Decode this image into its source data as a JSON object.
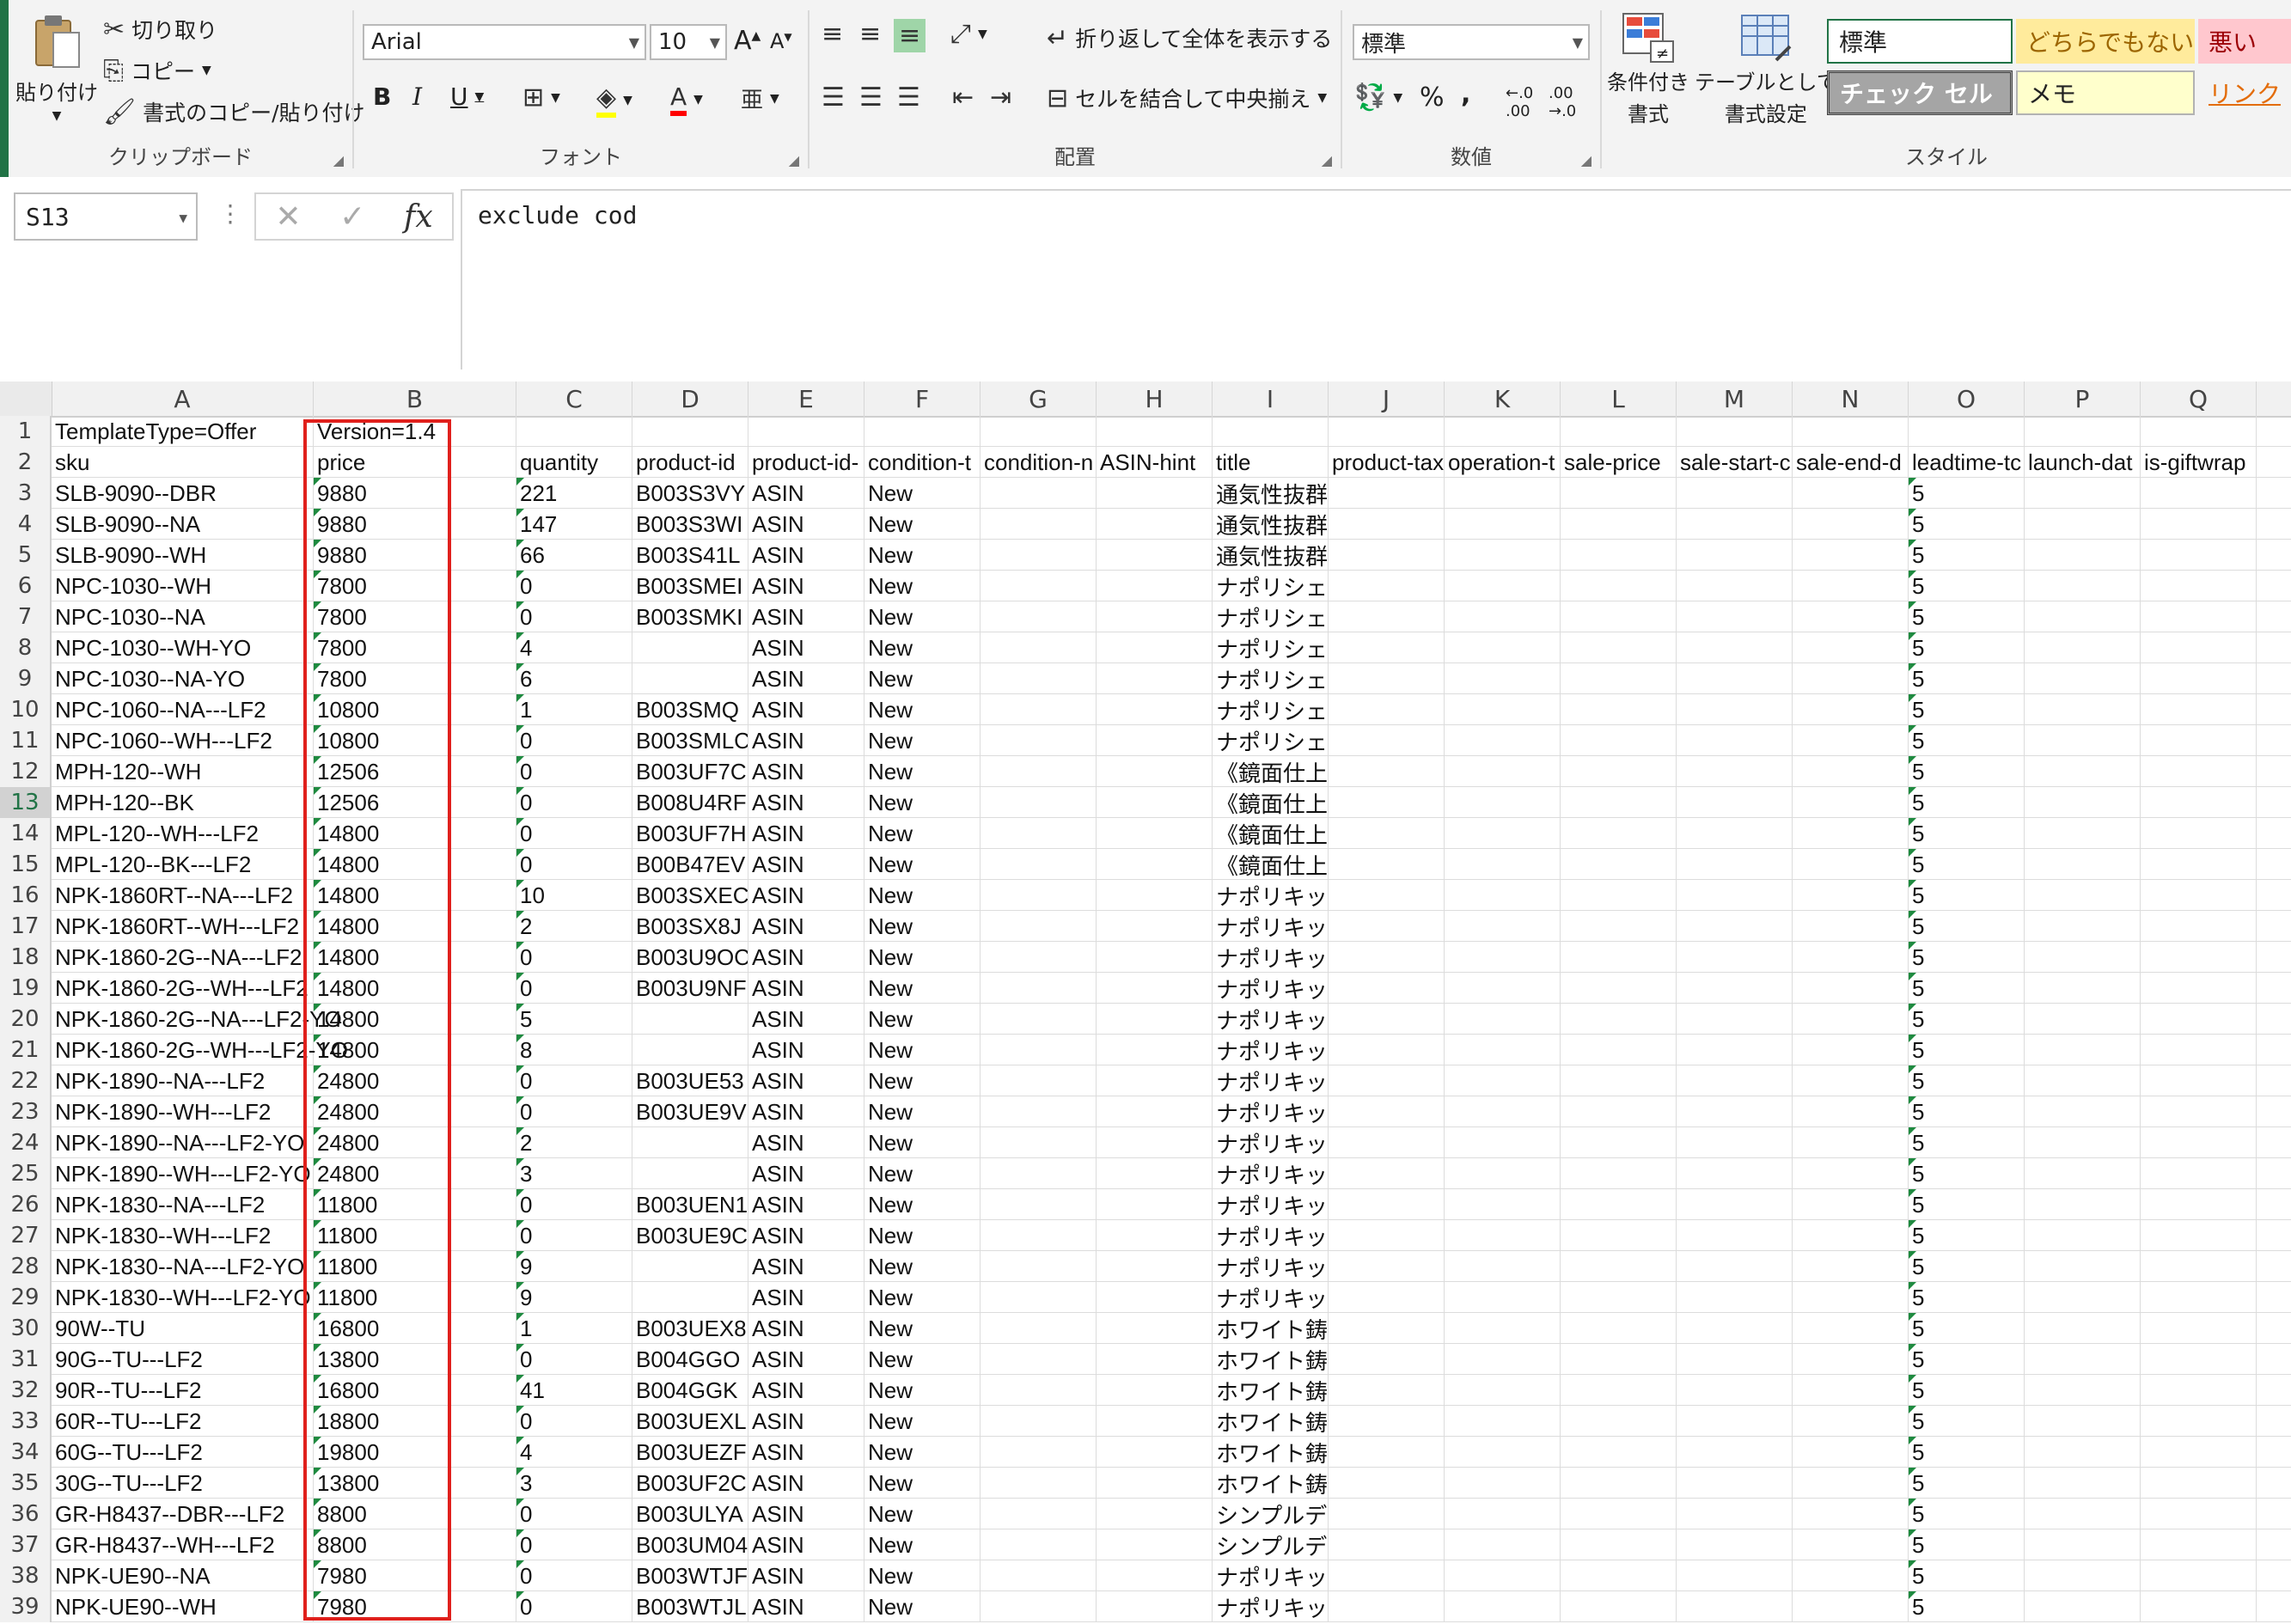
{
  "ribbon": {
    "clipboard": {
      "paste": "貼り付け",
      "cut": "切り取り",
      "copy": "コピー",
      "format_painter": "書式のコピー/貼り付け",
      "label": "クリップボード"
    },
    "font": {
      "name": "Arial",
      "size": "10",
      "bold": "B",
      "italic": "I",
      "underline": "U",
      "label": "フォント"
    },
    "alignment": {
      "wrap_text": "折り返して全体を表示する",
      "merge_center": "セルを結合して中央揃え",
      "label": "配置"
    },
    "number": {
      "format": "標準",
      "percent": "%",
      "comma": ",",
      "label": "数値"
    },
    "styles": {
      "conditional": [
        "条件付き",
        "書式"
      ],
      "format_table": [
        "テーブルとして",
        "書式設定"
      ],
      "normal": "標準",
      "neutral": "どちらでもない",
      "bad": "悪い",
      "check_cell": "チェック セル",
      "note": "メモ",
      "link": "リンク",
      "label": "スタイル"
    },
    "colors": {
      "accent": "#217346",
      "neutral_bg": "#ffeb9c",
      "neutral_fg": "#9c6500",
      "bad_bg": "#ffc7ce",
      "bad_fg": "#9c0006",
      "check_bg": "#a5a5a5",
      "link_fg": "#e36c09",
      "highlight_red": "#e0201c"
    }
  },
  "formula_bar": {
    "name_box": "S13",
    "fx": "fx",
    "content": "exclude cod"
  },
  "sheet": {
    "selected_row": "13",
    "columns": [
      "A",
      "B",
      "C",
      "D",
      "E",
      "F",
      "G",
      "H",
      "I",
      "J",
      "K",
      "L",
      "M",
      "N",
      "O",
      "P",
      "Q"
    ],
    "rows": [
      {
        "n": "1",
        "cells": [
          "TemplateType=Offer",
          "Version=1.4",
          "",
          "",
          "",
          "",
          "",
          "",
          "",
          "",
          "",
          "",
          "",
          "",
          "",
          "",
          ""
        ]
      },
      {
        "n": "2",
        "cells": [
          "sku",
          "price",
          "quantity",
          "product-id",
          "product-id-",
          "condition-t",
          "condition-n",
          "ASIN-hint",
          "title",
          "product-tax",
          "operation-t",
          "sale-price",
          "sale-start-c",
          "sale-end-d",
          "leadtime-tc",
          "launch-dat",
          "is-giftwrap"
        ]
      },
      {
        "n": "3",
        "cells": [
          "SLB-9090--DBR",
          "9880",
          "221",
          "B003S3VY",
          "ASIN",
          "New",
          "",
          "",
          "通気性抜群",
          "",
          "",
          "",
          "",
          "",
          "5",
          "",
          ""
        ]
      },
      {
        "n": "4",
        "cells": [
          "SLB-9090--NA",
          "9880",
          "147",
          "B003S3WI",
          "ASIN",
          "New",
          "",
          "",
          "通気性抜群",
          "",
          "",
          "",
          "",
          "",
          "5",
          "",
          ""
        ]
      },
      {
        "n": "5",
        "cells": [
          "SLB-9090--WH",
          "9880",
          "66",
          "B003S41L",
          "ASIN",
          "New",
          "",
          "",
          "通気性抜群",
          "",
          "",
          "",
          "",
          "",
          "5",
          "",
          ""
        ]
      },
      {
        "n": "6",
        "cells": [
          "NPC-1030--WH",
          "7800",
          "0",
          "B003SMEI",
          "ASIN",
          "New",
          "",
          "",
          "ナポリシェ",
          "",
          "",
          "",
          "",
          "",
          "5",
          "",
          ""
        ]
      },
      {
        "n": "7",
        "cells": [
          "NPC-1030--NA",
          "7800",
          "0",
          "B003SMKI",
          "ASIN",
          "New",
          "",
          "",
          "ナポリシェ",
          "",
          "",
          "",
          "",
          "",
          "5",
          "",
          ""
        ]
      },
      {
        "n": "8",
        "cells": [
          "NPC-1030--WH-YO",
          "7800",
          "4",
          "",
          "ASIN",
          "New",
          "",
          "",
          "ナポリシェ",
          "",
          "",
          "",
          "",
          "",
          "5",
          "",
          ""
        ]
      },
      {
        "n": "9",
        "cells": [
          "NPC-1030--NA-YO",
          "7800",
          "6",
          "",
          "ASIN",
          "New",
          "",
          "",
          "ナポリシェ",
          "",
          "",
          "",
          "",
          "",
          "5",
          "",
          ""
        ]
      },
      {
        "n": "10",
        "cells": [
          "NPC-1060--NA---LF2",
          "10800",
          "1",
          "B003SMQ",
          "ASIN",
          "New",
          "",
          "",
          "ナポリシェ",
          "",
          "",
          "",
          "",
          "",
          "5",
          "",
          ""
        ]
      },
      {
        "n": "11",
        "cells": [
          "NPC-1060--WH---LF2",
          "10800",
          "0",
          "B003SMLC",
          "ASIN",
          "New",
          "",
          "",
          "ナポリシェ",
          "",
          "",
          "",
          "",
          "",
          "5",
          "",
          ""
        ]
      },
      {
        "n": "12",
        "cells": [
          "MPH-120--WH",
          "12506",
          "0",
          "B003UF7C",
          "ASIN",
          "New",
          "",
          "",
          "《鏡面仕上",
          "",
          "",
          "",
          "",
          "",
          "5",
          "",
          ""
        ]
      },
      {
        "n": "13",
        "cells": [
          "MPH-120--BK",
          "12506",
          "0",
          "B008U4RF",
          "ASIN",
          "New",
          "",
          "",
          "《鏡面仕上",
          "",
          "",
          "",
          "",
          "",
          "5",
          "",
          ""
        ]
      },
      {
        "n": "14",
        "cells": [
          "MPL-120--WH---LF2",
          "14800",
          "0",
          "B003UF7H",
          "ASIN",
          "New",
          "",
          "",
          "《鏡面仕上",
          "",
          "",
          "",
          "",
          "",
          "5",
          "",
          ""
        ]
      },
      {
        "n": "15",
        "cells": [
          "MPL-120--BK---LF2",
          "14800",
          "0",
          "B00B47EV",
          "ASIN",
          "New",
          "",
          "",
          "《鏡面仕上",
          "",
          "",
          "",
          "",
          "",
          "5",
          "",
          ""
        ]
      },
      {
        "n": "16",
        "cells": [
          "NPK-1860RT--NA---LF2",
          "14800",
          "10",
          "B003SXEC",
          "ASIN",
          "New",
          "",
          "",
          "ナポリキッ",
          "",
          "",
          "",
          "",
          "",
          "5",
          "",
          ""
        ]
      },
      {
        "n": "17",
        "cells": [
          "NPK-1860RT--WH---LF2",
          "14800",
          "2",
          "B003SX8J",
          "ASIN",
          "New",
          "",
          "",
          "ナポリキッ",
          "",
          "",
          "",
          "",
          "",
          "5",
          "",
          ""
        ]
      },
      {
        "n": "18",
        "cells": [
          "NPK-1860-2G--NA---LF2",
          "14800",
          "0",
          "B003U9OC",
          "ASIN",
          "New",
          "",
          "",
          "ナポリキッ",
          "",
          "",
          "",
          "",
          "",
          "5",
          "",
          ""
        ]
      },
      {
        "n": "19",
        "cells": [
          "NPK-1860-2G--WH---LF2",
          "14800",
          "0",
          "B003U9NF",
          "ASIN",
          "New",
          "",
          "",
          "ナポリキッ",
          "",
          "",
          "",
          "",
          "",
          "5",
          "",
          ""
        ]
      },
      {
        "n": "20",
        "cells": [
          "NPK-1860-2G--NA---LF2-YO",
          "14800",
          "5",
          "",
          "ASIN",
          "New",
          "",
          "",
          "ナポリキッ",
          "",
          "",
          "",
          "",
          "",
          "5",
          "",
          ""
        ]
      },
      {
        "n": "21",
        "cells": [
          "NPK-1860-2G--WH---LF2-YO",
          "14800",
          "8",
          "",
          "ASIN",
          "New",
          "",
          "",
          "ナポリキッ",
          "",
          "",
          "",
          "",
          "",
          "5",
          "",
          ""
        ]
      },
      {
        "n": "22",
        "cells": [
          "NPK-1890--NA---LF2",
          "24800",
          "0",
          "B003UE53",
          "ASIN",
          "New",
          "",
          "",
          "ナポリキッ",
          "",
          "",
          "",
          "",
          "",
          "5",
          "",
          ""
        ]
      },
      {
        "n": "23",
        "cells": [
          "NPK-1890--WH---LF2",
          "24800",
          "0",
          "B003UE9V",
          "ASIN",
          "New",
          "",
          "",
          "ナポリキッ",
          "",
          "",
          "",
          "",
          "",
          "5",
          "",
          ""
        ]
      },
      {
        "n": "24",
        "cells": [
          "NPK-1890--NA---LF2-YO",
          "24800",
          "2",
          "",
          "ASIN",
          "New",
          "",
          "",
          "ナポリキッ",
          "",
          "",
          "",
          "",
          "",
          "5",
          "",
          ""
        ]
      },
      {
        "n": "25",
        "cells": [
          "NPK-1890--WH---LF2-YO",
          "24800",
          "3",
          "",
          "ASIN",
          "New",
          "",
          "",
          "ナポリキッ",
          "",
          "",
          "",
          "",
          "",
          "5",
          "",
          ""
        ]
      },
      {
        "n": "26",
        "cells": [
          "NPK-1830--NA---LF2",
          "11800",
          "0",
          "B003UEN1",
          "ASIN",
          "New",
          "",
          "",
          "ナポリキッ",
          "",
          "",
          "",
          "",
          "",
          "5",
          "",
          ""
        ]
      },
      {
        "n": "27",
        "cells": [
          "NPK-1830--WH---LF2",
          "11800",
          "0",
          "B003UE9C",
          "ASIN",
          "New",
          "",
          "",
          "ナポリキッ",
          "",
          "",
          "",
          "",
          "",
          "5",
          "",
          ""
        ]
      },
      {
        "n": "28",
        "cells": [
          "NPK-1830--NA---LF2-YO",
          "11800",
          "9",
          "",
          "ASIN",
          "New",
          "",
          "",
          "ナポリキッ",
          "",
          "",
          "",
          "",
          "",
          "5",
          "",
          ""
        ]
      },
      {
        "n": "29",
        "cells": [
          "NPK-1830--WH---LF2-YO",
          "11800",
          "9",
          "",
          "ASIN",
          "New",
          "",
          "",
          "ナポリキッ",
          "",
          "",
          "",
          "",
          "",
          "5",
          "",
          ""
        ]
      },
      {
        "n": "30",
        "cells": [
          "90W--TU",
          "16800",
          "1",
          "B003UEX8",
          "ASIN",
          "New",
          "",
          "",
          "ホワイト鋳",
          "",
          "",
          "",
          "",
          "",
          "5",
          "",
          ""
        ]
      },
      {
        "n": "31",
        "cells": [
          "90G--TU---LF2",
          "13800",
          "0",
          "B004GGO",
          "ASIN",
          "New",
          "",
          "",
          "ホワイト鋳",
          "",
          "",
          "",
          "",
          "",
          "5",
          "",
          ""
        ]
      },
      {
        "n": "32",
        "cells": [
          "90R--TU---LF2",
          "16800",
          "41",
          "B004GGK",
          "ASIN",
          "New",
          "",
          "",
          "ホワイト鋳",
          "",
          "",
          "",
          "",
          "",
          "5",
          "",
          ""
        ]
      },
      {
        "n": "33",
        "cells": [
          "60R--TU---LF2",
          "18800",
          "0",
          "B003UEXL",
          "ASIN",
          "New",
          "",
          "",
          "ホワイト鋳",
          "",
          "",
          "",
          "",
          "",
          "5",
          "",
          ""
        ]
      },
      {
        "n": "34",
        "cells": [
          "60G--TU---LF2",
          "19800",
          "4",
          "B003UEZF",
          "ASIN",
          "New",
          "",
          "",
          "ホワイト鋳",
          "",
          "",
          "",
          "",
          "",
          "5",
          "",
          ""
        ]
      },
      {
        "n": "35",
        "cells": [
          "30G--TU---LF2",
          "13800",
          "3",
          "B003UF2C",
          "ASIN",
          "New",
          "",
          "",
          "ホワイト鋳",
          "",
          "",
          "",
          "",
          "",
          "5",
          "",
          ""
        ]
      },
      {
        "n": "36",
        "cells": [
          "GR-H8437--DBR---LF2",
          "8800",
          "0",
          "B003ULYA",
          "ASIN",
          "New",
          "",
          "",
          "シンプルデ",
          "",
          "",
          "",
          "",
          "",
          "5",
          "",
          ""
        ]
      },
      {
        "n": "37",
        "cells": [
          "GR-H8437--WH---LF2",
          "8800",
          "0",
          "B003UM04",
          "ASIN",
          "New",
          "",
          "",
          "シンプルデ",
          "",
          "",
          "",
          "",
          "",
          "5",
          "",
          ""
        ]
      },
      {
        "n": "38",
        "cells": [
          "NPK-UE90--NA",
          "7980",
          "0",
          "B003WTJF",
          "ASIN",
          "New",
          "",
          "",
          "ナポリキッ",
          "",
          "",
          "",
          "",
          "",
          "5",
          "",
          ""
        ]
      },
      {
        "n": "39",
        "cells": [
          "NPK-UE90--WH",
          "7980",
          "0",
          "B003WTJL",
          "ASIN",
          "New",
          "",
          "",
          "ナポリキッ",
          "",
          "",
          "",
          "",
          "",
          "5",
          "",
          ""
        ]
      }
    ]
  }
}
